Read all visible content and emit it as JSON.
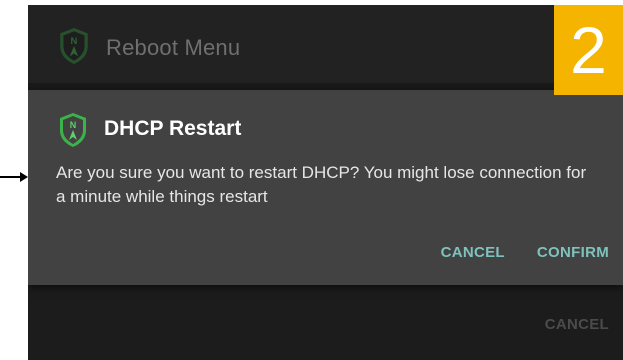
{
  "background_dialog": {
    "title": "Reboot Menu",
    "cancel_label": "CANCEL"
  },
  "dialog": {
    "title": "DHCP Restart",
    "message": "Are you sure you want to restart DHCP?  You might lose connection for a minute while things restart",
    "cancel_label": "CANCEL",
    "confirm_label": "CONFIRM"
  },
  "step_badge": "2",
  "icons": {
    "app_logo": "shield-n-icon",
    "pointer": "arrow-right-icon"
  },
  "colors": {
    "accent": "#7fc2bd",
    "badge": "#f5b400",
    "logo_green": "#3cb34a",
    "dialog_bg": "#424242"
  }
}
